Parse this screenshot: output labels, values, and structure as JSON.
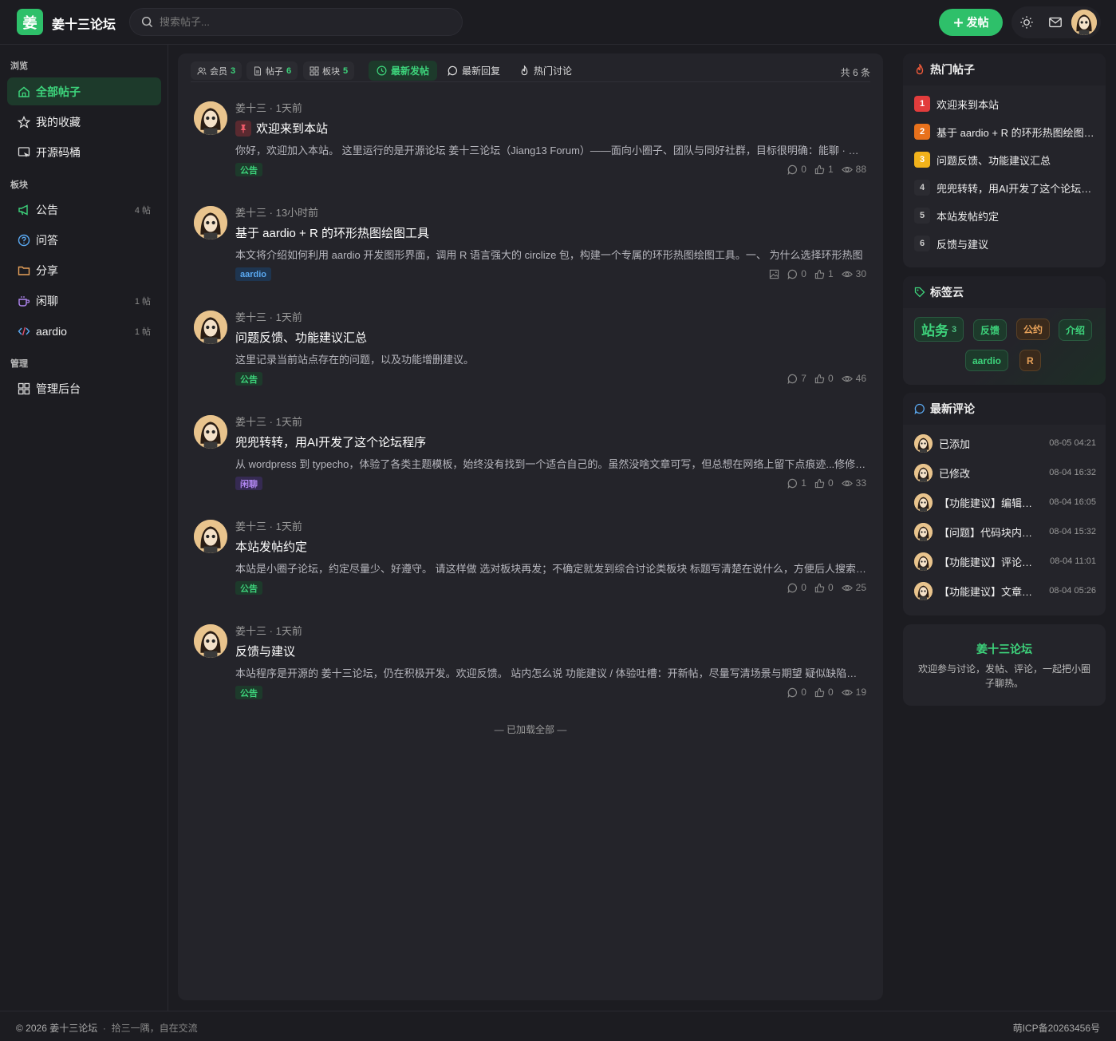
{
  "header": {
    "logo_char": "姜",
    "site_name": "姜十三论坛",
    "search_placeholder": "搜索帖子...",
    "post_button": "发帖"
  },
  "sidebar": {
    "sections": [
      "浏览",
      "板块",
      "管理"
    ],
    "browse": [
      {
        "label": "全部帖子",
        "icon": "home-icon",
        "active": true
      },
      {
        "label": "我的收藏",
        "icon": "star-icon"
      },
      {
        "label": "开源码桶",
        "icon": "bucket-icon"
      }
    ],
    "boards": [
      {
        "label": "公告",
        "icon": "megaphone-icon",
        "count": "4 帖"
      },
      {
        "label": "问答",
        "icon": "question-icon",
        "count": ""
      },
      {
        "label": "分享",
        "icon": "folder-icon",
        "count": ""
      },
      {
        "label": "闲聊",
        "icon": "coffee-icon",
        "count": "1 帖"
      },
      {
        "label": "aardio",
        "icon": "code-icon",
        "count": "1 帖"
      }
    ],
    "manage": [
      {
        "label": "管理后台",
        "icon": "dashboard-icon"
      }
    ]
  },
  "tabbar": {
    "stats": [
      {
        "label": "会员",
        "value": "3"
      },
      {
        "label": "帖子",
        "value": "6"
      },
      {
        "label": "板块",
        "value": "5"
      }
    ],
    "tabs": [
      "最新发帖",
      "最新回复",
      "热门讨论"
    ],
    "total": "共 6 条"
  },
  "posts": [
    {
      "author": "姜十三",
      "time": "1天前",
      "title": "欢迎来到本站",
      "pinned": true,
      "excerpt": "你好，欢迎加入本站。 这里运行的是开源论坛 姜十三论坛（Jiang13 Forum）——面向小圈子、团队与同好社群，目标很明确：能聊 · 能存 · 能找 · 能运营，轻量可部署",
      "tag": "公告",
      "tag_color": "green",
      "comments": "0",
      "likes": "1",
      "views": "88",
      "has_image": false
    },
    {
      "author": "姜十三",
      "time": "13小时前",
      "title": "基于 aardio + R 的环形热图绘图工具",
      "pinned": false,
      "excerpt": "本文将介绍如何利用 aardio 开发图形界面，调用 R 语言强大的 circlize 包，构建一个专属的环形热图绘图工具。一、 为什么选择环形热图",
      "tag": "aardio",
      "tag_color": "blue",
      "comments": "0",
      "likes": "1",
      "views": "30",
      "has_image": true
    },
    {
      "author": "姜十三",
      "time": "1天前",
      "title": "问题反馈、功能建议汇总",
      "pinned": false,
      "excerpt": "这里记录当前站点存在的问题，以及功能增删建议。",
      "tag": "公告",
      "tag_color": "green",
      "comments": "7",
      "likes": "0",
      "views": "46",
      "has_image": false
    },
    {
      "author": "姜十三",
      "time": "1天前",
      "title": "兜兜转转，用AI开发了这个论坛程序",
      "pinned": false,
      "excerpt": "从 wordpress 到 typecho，体验了各类主题模板，始终没有找到一个适合自己的。虽然没啥文章可写，但总想在网络上留下点痕迹...修修改改",
      "tag": "闲聊",
      "tag_color": "purple",
      "comments": "1",
      "likes": "0",
      "views": "33",
      "has_image": false
    },
    {
      "author": "姜十三",
      "time": "1天前",
      "title": "本站发帖约定",
      "pinned": false,
      "excerpt": "本站是小圈子论坛，约定尽量少、好遵守。 请这样做 选对板块再发；不确定就发到综合讨论类板块 标题写清楚在说什么，方便后人搜索检索",
      "tag": "公告",
      "tag_color": "green",
      "comments": "0",
      "likes": "0",
      "views": "25",
      "has_image": false
    },
    {
      "author": "姜十三",
      "time": "1天前",
      "title": "反馈与建议",
      "pinned": false,
      "excerpt": "本站程序是开源的 姜十三论坛，仍在积极开发。欢迎反馈。 站内怎么说 功能建议 / 体验吐槽：开新帖，尽量写清场景与期望 疑似缺陷：附上复现",
      "tag": "公告",
      "tag_color": "green",
      "comments": "0",
      "likes": "0",
      "views": "19",
      "has_image": false
    }
  ],
  "end_text": "— 已加载全部 —",
  "hot": {
    "title": "热门帖子",
    "items": [
      "欢迎来到本站",
      "基于 aardio + R 的环形热图绘图工具",
      "问题反馈、功能建议汇总",
      "兜兜转转，用AI开发了这个论坛程序",
      "本站发帖约定",
      "反馈与建议"
    ]
  },
  "cloud": {
    "title": "标签云",
    "tags": [
      {
        "label": "站务",
        "count": "3"
      },
      {
        "label": "反馈"
      },
      {
        "label": "公约"
      },
      {
        "label": "介绍"
      },
      {
        "label": "aardio"
      },
      {
        "label": "R"
      }
    ]
  },
  "comments": {
    "title": "最新评论",
    "items": [
      {
        "text": "已添加",
        "date": "08-05 04:21"
      },
      {
        "text": "已修改",
        "date": "08-04 16:32"
      },
      {
        "text": "【功能建议】编辑器支持预览",
        "date": "08-04 16:05"
      },
      {
        "text": "【问题】代码块内容显示异常",
        "date": "08-04 15:32"
      },
      {
        "text": "【功能建议】评论支持引用",
        "date": "08-04 11:01"
      },
      {
        "text": "【功能建议】文章支持草稿",
        "date": "08-04 05:26"
      }
    ]
  },
  "about": {
    "title": "姜十三论坛",
    "desc": "欢迎参与讨论，发帖、评论，一起把小圈子聊热。"
  },
  "footer": {
    "copyright": "© 2026 姜十三论坛",
    "slogan": "拾三一隅，自在交流",
    "icp": "萌ICP备20263456号"
  },
  "colors": {
    "accent": "#2ec06a",
    "background": "#1c1c21",
    "card": "#24242a"
  }
}
